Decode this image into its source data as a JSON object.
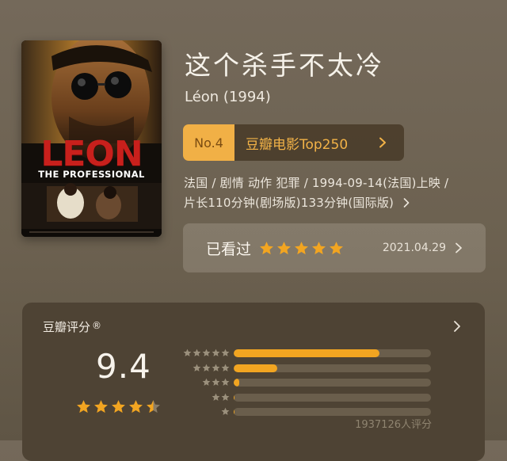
{
  "movie": {
    "title": "这个杀手不太冷",
    "original_title": "Léon (1994)",
    "poster": {
      "title": "LEON",
      "subtitle": "THE PROFESSIONAL"
    },
    "info_line_1": "法国 / 剧情 动作 犯罪 / 1994-09-14(法国)上映 /",
    "info_line_2": "片长110分钟(剧场版)133分钟(国际版)"
  },
  "ranking": {
    "number": "No.4",
    "list_name": "豆瓣电影Top250"
  },
  "my_status": {
    "label": "已看过",
    "my_stars": 5,
    "date": "2021.04.29"
  },
  "rating": {
    "heading": "豆瓣评分",
    "registered_mark": "®",
    "score": "9.4",
    "score_stars": 4.5,
    "count_text": "1937126人评分",
    "distribution": [
      {
        "stars": 5,
        "fraction": 0.74
      },
      {
        "stars": 4,
        "fraction": 0.22
      },
      {
        "stars": 3,
        "fraction": 0.03
      },
      {
        "stars": 2,
        "fraction": 0.004
      },
      {
        "stars": 1,
        "fraction": 0.002
      }
    ]
  },
  "colors": {
    "accent": "#f2a521",
    "rank_badge": "#f1b046",
    "background": "#6e6350",
    "card": "#4e4334"
  },
  "icons": {
    "chevron": "chevron-right-icon",
    "star": "star-icon"
  }
}
